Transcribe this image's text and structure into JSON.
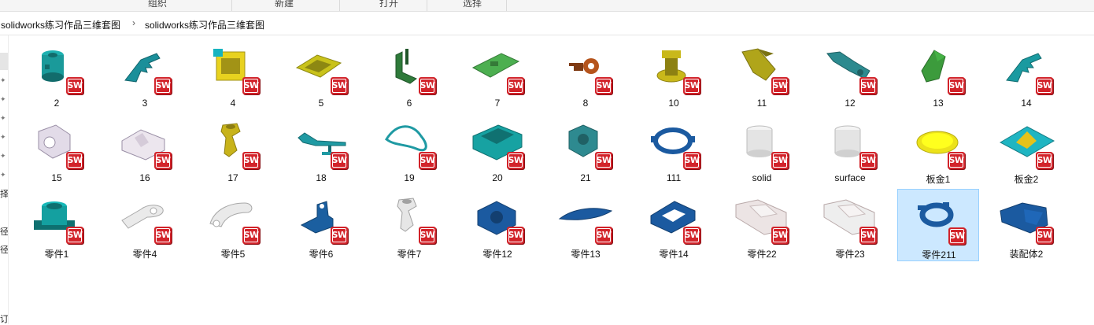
{
  "ribbon": {
    "groups": [
      "组织",
      "新建",
      "打开",
      "选择"
    ]
  },
  "address": {
    "crumbs": [
      "solidworks练习作品三维套图",
      "solidworks练习作品三维套图"
    ]
  },
  "nav": {
    "fragments": [
      "择",
      "径",
      "径",
      "订"
    ]
  },
  "file_badge_text": "SW",
  "files": [
    {
      "label": "2",
      "shape": "cyl",
      "color": "#1a9a9a",
      "selected": false
    },
    {
      "label": "3",
      "shape": "claw",
      "color": "#1a8f9a",
      "selected": false
    },
    {
      "label": "4",
      "shape": "block",
      "color": "#e8d21f",
      "selected": false
    },
    {
      "label": "5",
      "shape": "tray",
      "color": "#c9c21a",
      "selected": false
    },
    {
      "label": "6",
      "shape": "bracket",
      "color": "#2e7a3a",
      "selected": false
    },
    {
      "label": "7",
      "shape": "plate",
      "color": "#4caf50",
      "selected": false
    },
    {
      "label": "8",
      "shape": "hook",
      "color": "#b5541c",
      "selected": false
    },
    {
      "label": "10",
      "shape": "stand",
      "color": "#c9b81a",
      "selected": false
    },
    {
      "label": "11",
      "shape": "scoop",
      "color": "#b0a51a",
      "selected": false
    },
    {
      "label": "12",
      "shape": "arm",
      "color": "#2c8a8f",
      "selected": false
    },
    {
      "label": "13",
      "shape": "wedge",
      "color": "#3c9b3c",
      "selected": false
    },
    {
      "label": "14",
      "shape": "claw",
      "color": "#1a9aa0",
      "selected": false
    },
    {
      "label": "15",
      "shape": "cube",
      "color": "#e2dbe8",
      "selected": false
    },
    {
      "label": "16",
      "shape": "vblock",
      "color": "#ece6ee",
      "selected": false
    },
    {
      "label": "17",
      "shape": "pipe",
      "color": "#c8b31a",
      "selected": false
    },
    {
      "label": "18",
      "shape": "lever",
      "color": "#1f9aa3",
      "selected": false
    },
    {
      "label": "19",
      "shape": "loop",
      "color": "#1f9aa3",
      "selected": false
    },
    {
      "label": "20",
      "shape": "box",
      "color": "#17a2a2",
      "selected": false
    },
    {
      "label": "21",
      "shape": "hex",
      "color": "#2e8a90",
      "selected": false
    },
    {
      "label": "111",
      "shape": "ring",
      "color": "#1b5aa0",
      "selected": false
    },
    {
      "label": "solid",
      "shape": "cyl2",
      "color": "#e4e4e4",
      "selected": false
    },
    {
      "label": "surface",
      "shape": "cyl2",
      "color": "#e4e4e4",
      "selected": false
    },
    {
      "label": "板金1",
      "shape": "disc",
      "color": "#ece21a",
      "selected": false
    },
    {
      "label": "板金2",
      "shape": "sheet",
      "color": "#1fb5c2",
      "selected": false
    },
    {
      "label": "零件1",
      "shape": "cupbase",
      "color": "#14a0a0",
      "selected": false
    },
    {
      "label": "零件4",
      "shape": "link",
      "color": "#eaeaea",
      "selected": false
    },
    {
      "label": "零件5",
      "shape": "hookw",
      "color": "#eaeaea",
      "selected": false
    },
    {
      "label": "零件6",
      "shape": "bracket2",
      "color": "#1b5fa0",
      "selected": false
    },
    {
      "label": "零件7",
      "shape": "pipe",
      "color": "#e6e6e6",
      "selected": false
    },
    {
      "label": "零件12",
      "shape": "cross",
      "color": "#1b5aa0",
      "selected": false
    },
    {
      "label": "零件13",
      "shape": "fan",
      "color": "#1b5aa0",
      "selected": false
    },
    {
      "label": "零件14",
      "shape": "frame",
      "color": "#1b5aa0",
      "selected": false
    },
    {
      "label": "零件22",
      "shape": "longplate",
      "color": "#ece4e4",
      "selected": false
    },
    {
      "label": "零件23",
      "shape": "longplate",
      "color": "#eeeeee",
      "selected": false
    },
    {
      "label": "零件211",
      "shape": "ring2",
      "color": "#1b5aa0",
      "selected": true
    },
    {
      "label": "装配体2",
      "shape": "assy",
      "color": "#1b5aa0",
      "selected": false
    }
  ]
}
